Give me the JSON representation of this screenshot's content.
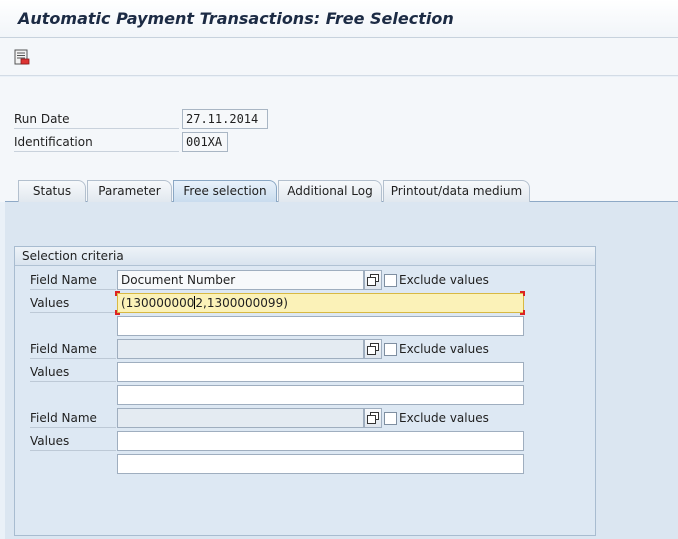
{
  "window": {
    "title": "Automatic Payment Transactions: Free Selection"
  },
  "toolbar": {
    "items": [
      {
        "icon": "save-variant-icon"
      }
    ]
  },
  "header": {
    "run_date_label": "Run Date",
    "run_date_value": "27.11.2014",
    "identification_label": "Identification",
    "identification_value": "001XA"
  },
  "tabs": [
    {
      "label": "Status",
      "active": false
    },
    {
      "label": "Parameter",
      "active": false
    },
    {
      "label": "Free selection",
      "active": true
    },
    {
      "label": "Additional Log",
      "active": false
    },
    {
      "label": "Printout/data medium",
      "active": false
    }
  ],
  "selection": {
    "group_title": "Selection criteria",
    "field_name_label": "Field Name",
    "values_label": "Values",
    "exclude_label": "Exclude values",
    "rows": [
      {
        "field_name": "Document Number",
        "value_1_before_cursor": "(130000000",
        "value_1_after_cursor": "2,1300000099)",
        "value_2": "",
        "exclude": false
      },
      {
        "field_name": "",
        "value_1": "",
        "value_2": "",
        "exclude": false
      },
      {
        "field_name": "",
        "value_1": "",
        "value_2": "",
        "exclude": false
      }
    ]
  },
  "colors": {
    "focus_field": "#fbf2b8",
    "panel": "#dbe6f1",
    "title_text": "#1c2b44"
  }
}
